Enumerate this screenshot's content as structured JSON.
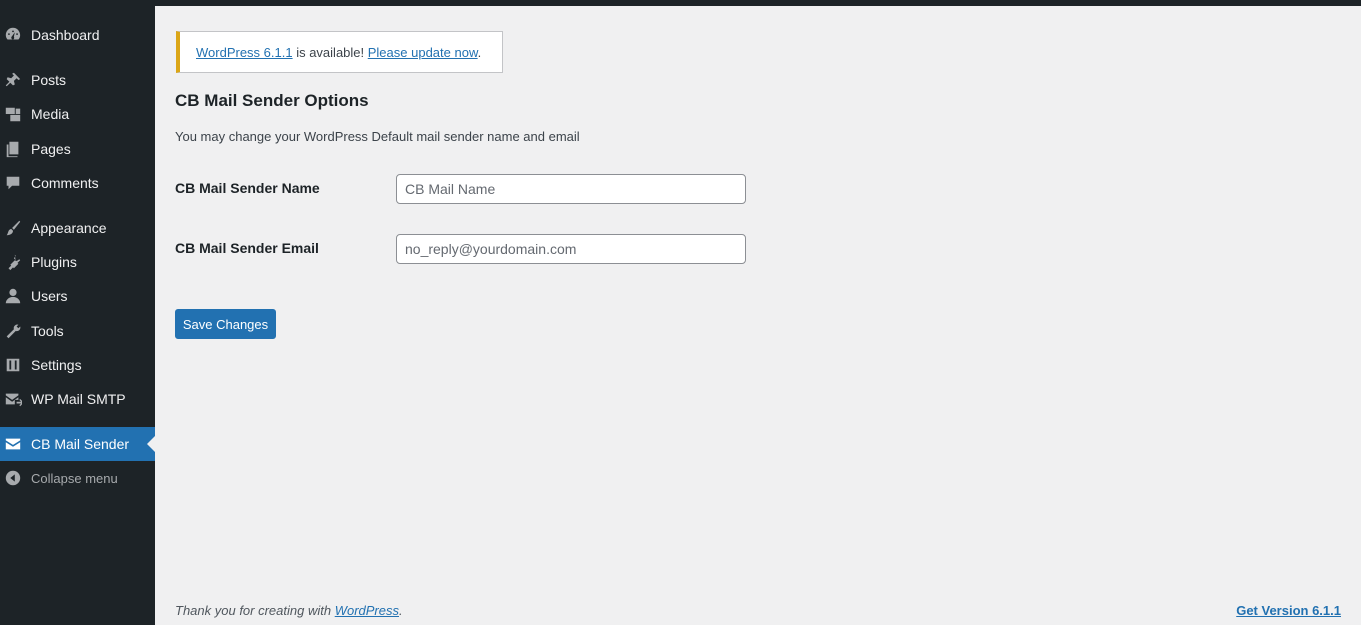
{
  "sidebar": {
    "items": [
      {
        "label": "Dashboard",
        "icon": "dashboard-icon"
      },
      {
        "label": "Posts",
        "icon": "pin-icon"
      },
      {
        "label": "Media",
        "icon": "media-icon"
      },
      {
        "label": "Pages",
        "icon": "pages-icon"
      },
      {
        "label": "Comments",
        "icon": "comment-icon"
      },
      {
        "label": "Appearance",
        "icon": "brush-icon"
      },
      {
        "label": "Plugins",
        "icon": "plug-icon"
      },
      {
        "label": "Users",
        "icon": "user-icon"
      },
      {
        "label": "Tools",
        "icon": "wrench-icon"
      },
      {
        "label": "Settings",
        "icon": "sliders-icon"
      },
      {
        "label": "WP Mail SMTP",
        "icon": "mail-smtp-icon"
      },
      {
        "label": "CB Mail Sender",
        "icon": "envelope-icon",
        "current": true
      }
    ],
    "collapse_label": "Collapse menu",
    "accent": "#2271b1",
    "background": "#1d2327"
  },
  "notice": {
    "version_link": "WordPress 6.1.1",
    "middle_text": " is available! ",
    "update_link": "Please update now",
    "end_text": ".",
    "border_color": "#dba617"
  },
  "main": {
    "title": "CB Mail Sender Options",
    "description": "You may change your WordPress Default mail sender name and email",
    "fields": [
      {
        "label": "CB Mail Sender Name",
        "value": "",
        "placeholder": "CB Mail Name"
      },
      {
        "label": "CB Mail Sender Email",
        "value": "",
        "placeholder": "no_reply@yourdomain.com"
      }
    ],
    "save_label": "Save Changes"
  },
  "footer": {
    "thanks_text": "Thank you for creating with ",
    "wordpress_link": "WordPress",
    "thanks_end": ".",
    "version_link": "Get Version 6.1.1"
  }
}
